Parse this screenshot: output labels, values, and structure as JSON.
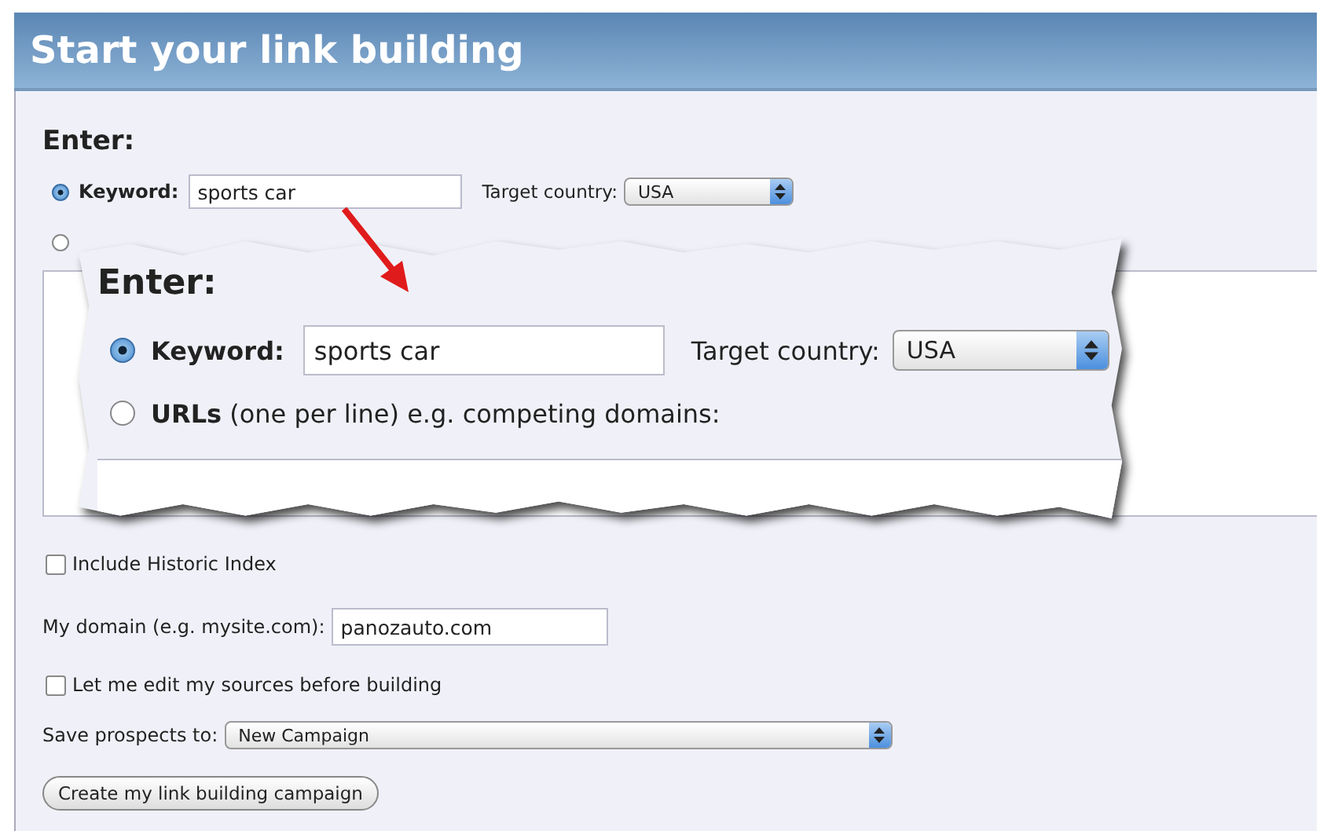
{
  "title": "Start your link building",
  "form": {
    "heading": "Enter:",
    "keyword": {
      "label": "Keyword:",
      "value": "sports car",
      "selected": true
    },
    "target_country": {
      "label": "Target country:",
      "value": "USA"
    },
    "urls": {
      "selected": false
    },
    "include_historic": {
      "label": "Include Historic Index",
      "checked": false
    },
    "domain": {
      "label": "My domain (e.g. mysite.com):",
      "value": "panozauto.com"
    },
    "edit_sources": {
      "label": "Let me edit my sources before building",
      "checked": false
    },
    "save_prospects": {
      "label": "Save prospects to:",
      "value": "New Campaign"
    },
    "button": "Create my link building campaign"
  },
  "callout": {
    "heading": "Enter:",
    "keyword": {
      "label": "Keyword:",
      "value": "sports car",
      "selected": true
    },
    "target_country": {
      "label": "Target country:",
      "value": "USA"
    },
    "urls": {
      "label": "**URLs** (one per line) e.g. competing domains:",
      "selected": false
    }
  }
}
